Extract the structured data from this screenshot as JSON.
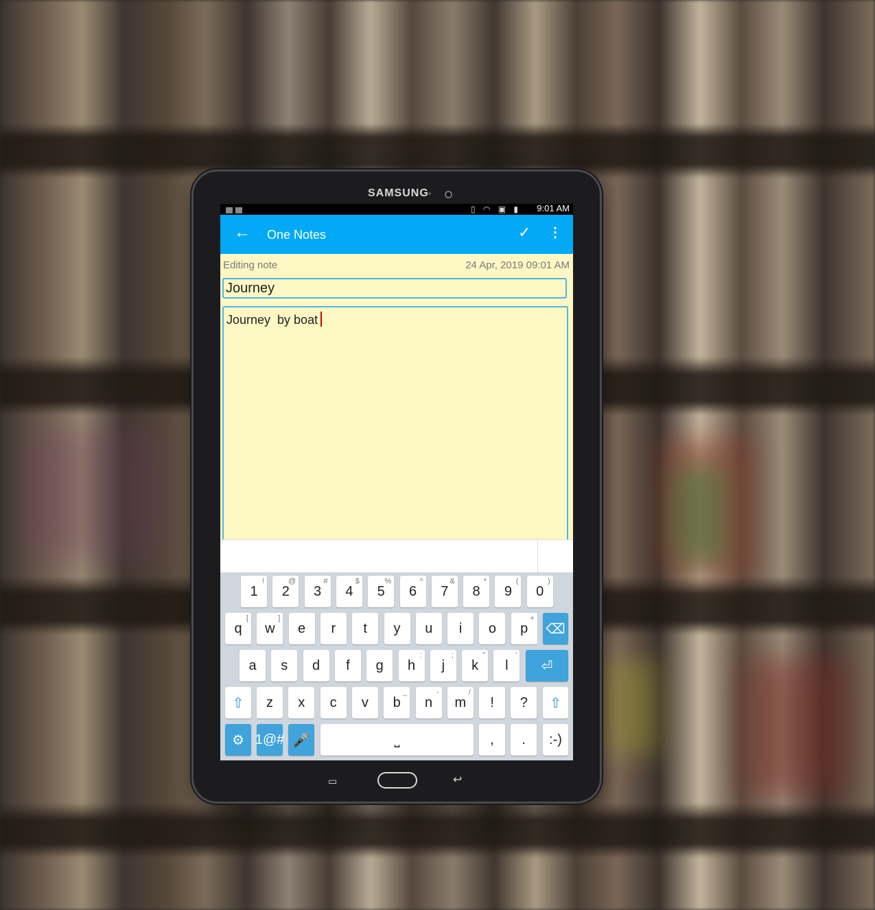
{
  "device": {
    "brand": "SAMSUNG"
  },
  "status_bar": {
    "time": "9:01 AM"
  },
  "app_bar": {
    "title": "One Notes"
  },
  "note": {
    "state_label": "Editing note",
    "timestamp": "24 Apr, 2019 09:01 AM",
    "title": "Journey",
    "body": "Journey  by boat"
  },
  "keyboard": {
    "row1": [
      {
        "k": "1",
        "s": "!"
      },
      {
        "k": "2",
        "s": "@"
      },
      {
        "k": "3",
        "s": "#"
      },
      {
        "k": "4",
        "s": "$"
      },
      {
        "k": "5",
        "s": "%"
      },
      {
        "k": "6",
        "s": "^"
      },
      {
        "k": "7",
        "s": "&"
      },
      {
        "k": "8",
        "s": "*"
      },
      {
        "k": "9",
        "s": "("
      },
      {
        "k": "0",
        "s": ")"
      }
    ],
    "row2": [
      {
        "k": "q",
        "s": "["
      },
      {
        "k": "w",
        "s": "]"
      },
      {
        "k": "e",
        "s": ""
      },
      {
        "k": "r",
        "s": ""
      },
      {
        "k": "t",
        "s": ""
      },
      {
        "k": "y",
        "s": ""
      },
      {
        "k": "u",
        "s": ""
      },
      {
        "k": "i",
        "s": ""
      },
      {
        "k": "o",
        "s": ""
      },
      {
        "k": "p",
        "s": "+"
      }
    ],
    "row3": [
      {
        "k": "a",
        "s": ""
      },
      {
        "k": "s",
        "s": ""
      },
      {
        "k": "d",
        "s": ""
      },
      {
        "k": "f",
        "s": ""
      },
      {
        "k": "g",
        "s": ""
      },
      {
        "k": "h",
        "s": ":"
      },
      {
        "k": "j",
        "s": ";"
      },
      {
        "k": "k",
        "s": "\""
      },
      {
        "k": "l",
        "s": "'"
      }
    ],
    "row4": [
      {
        "k": "z",
        "s": ""
      },
      {
        "k": "x",
        "s": ""
      },
      {
        "k": "c",
        "s": ""
      },
      {
        "k": "v",
        "s": ""
      },
      {
        "k": "b",
        "s": "_"
      },
      {
        "k": "n",
        "s": "-"
      },
      {
        "k": "m",
        "s": "/"
      },
      {
        "k": "!",
        "s": ""
      },
      {
        "k": "?",
        "s": ""
      }
    ],
    "symbols_label": "1@#",
    "comma": ",",
    "period": ".",
    "emoticon": ":-)"
  },
  "colors": {
    "accent": "#03a9f4",
    "key_blue": "#3fa3dc",
    "note_bg": "#fdf7c4"
  }
}
